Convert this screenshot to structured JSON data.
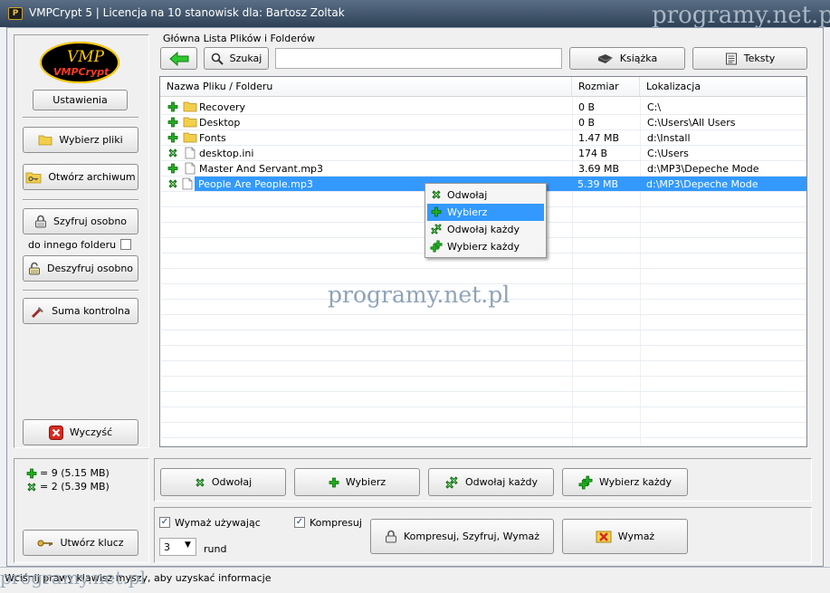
{
  "window": {
    "title": "VMPCrypt 5  |  Licencja na 10 stanowisk dla: Bartosz Zoltak"
  },
  "watermark": {
    "text": "programy.net.pl"
  },
  "logo": {
    "text_top": "VMP",
    "text_bottom": "VMPCrypt"
  },
  "sidebar": {
    "settings": "Ustawienia",
    "choose_files": "Wybierz pliki",
    "open_archive": "Otwórz archiwum",
    "encrypt_separately": "Szyfruj osobno",
    "to_other_folder": "do innego folderu",
    "to_other_folder_checked": false,
    "decrypt_separately": "Deszyfruj osobno",
    "checksum": "Suma kontrolna",
    "clear": "Wyczyść",
    "stat_selected": "= 9  (5.15 MB)",
    "stat_unselected": "= 2  (5.39 MB)",
    "create_key": "Utwórz klucz"
  },
  "main": {
    "list_label": "Główna Lista Plików i Folderów",
    "search_button": "Szukaj",
    "search_value": "",
    "book_button": "Książka",
    "texts_button": "Teksty"
  },
  "columns": {
    "name": "Nazwa Pliku / Folderu",
    "size": "Rozmiar",
    "location": "Lokalizacja"
  },
  "files": [
    {
      "mark": "plus",
      "type": "folder",
      "name": "Recovery",
      "size": "0 B",
      "location": "C:\\"
    },
    {
      "mark": "plus",
      "type": "folder",
      "name": "Desktop",
      "size": "0 B",
      "location": "C:\\Users\\All Users"
    },
    {
      "mark": "plus",
      "type": "folder",
      "name": "Fonts",
      "size": "1.47 MB",
      "location": "d:\\Install"
    },
    {
      "mark": "x",
      "type": "file",
      "name": "desktop.ini",
      "size": "174 B",
      "location": "C:\\Users"
    },
    {
      "mark": "plus",
      "type": "file",
      "name": "Master And Servant.mp3",
      "size": "3.69 MB",
      "location": "d:\\MP3\\Depeche Mode"
    },
    {
      "mark": "x",
      "type": "file",
      "name": "People Are People.mp3",
      "size": "5.39 MB",
      "location": "d:\\MP3\\Depeche Mode",
      "selected": true
    }
  ],
  "context_menu": {
    "items": [
      {
        "label": "Odwołaj",
        "icon": "x",
        "highlighted": false
      },
      {
        "label": "Wybierz",
        "icon": "plus",
        "highlighted": true
      },
      {
        "label": "Odwołaj każdy",
        "icon": "multi-x",
        "highlighted": false
      },
      {
        "label": "Wybierz każdy",
        "icon": "multi-plus",
        "highlighted": false
      }
    ]
  },
  "actions": {
    "undo": "Odwołaj",
    "select": "Wybierz",
    "undo_all": "Odwołaj każdy",
    "select_all": "Wybierz każdy"
  },
  "options": {
    "wipe_using": "Wymaż używając",
    "wipe_using_checked": true,
    "compress": "Kompresuj",
    "compress_checked": true,
    "rounds_value": "3",
    "rounds_label": "rund",
    "compress_encrypt_wipe": "Kompresuj, Szyfruj, Wymaż",
    "wipe": "Wymaż"
  },
  "statusbar": {
    "text": "Wciśnij prawy klawisz myszy, aby uzyskać informacje"
  },
  "colors": {
    "selection": "#3399ff",
    "plus": "#1fae1f",
    "x_mark": "#2a8a2a",
    "clear_red": "#d9281e",
    "folder": "#f2cf4a"
  }
}
